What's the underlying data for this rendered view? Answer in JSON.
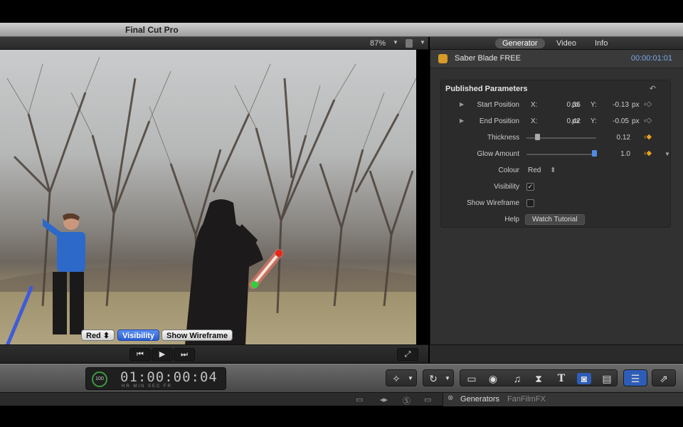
{
  "app": {
    "title": "Final Cut Pro"
  },
  "viewer": {
    "zoom": "87%",
    "overlay": {
      "colour_value": "Red",
      "visibility_label": "Visibility",
      "wireframe_label": "Show Wireframe"
    }
  },
  "inspector": {
    "tabs": [
      "Generator",
      "Video",
      "Info"
    ],
    "active_tab": "Generator",
    "generator_name": "Saber Blade FREE",
    "timecode": "00:00:01:01",
    "section_title": "Published Parameters",
    "params": {
      "start": {
        "label": "Start Position",
        "x_label": "X:",
        "x": "0.35",
        "y_label": "Y:",
        "y": "-0.13",
        "unit": "px"
      },
      "end": {
        "label": "End Position",
        "x_label": "X:",
        "x": "0.42",
        "y_label": "Y:",
        "y": "-0.05",
        "unit": "px"
      },
      "thickness": {
        "label": "Thickness",
        "value": "0.12",
        "level": 0.12
      },
      "glow": {
        "label": "Glow Amount",
        "value": "1.0",
        "level": 0.97
      },
      "colour": {
        "label": "Colour",
        "value": "Red"
      },
      "visibility": {
        "label": "Visibility",
        "checked": true,
        "check_glyph": "✓"
      },
      "wireframe": {
        "label": "Show Wireframe",
        "checked": false
      },
      "help": {
        "label": "Help",
        "button": "Watch Tutorial"
      }
    }
  },
  "toolbar": {
    "timecode": "01:00:00:04",
    "ring_value": "100",
    "units": "HR MIN SEC FR"
  },
  "browser": {
    "category": "Generators",
    "item": "FanFilmFX"
  }
}
